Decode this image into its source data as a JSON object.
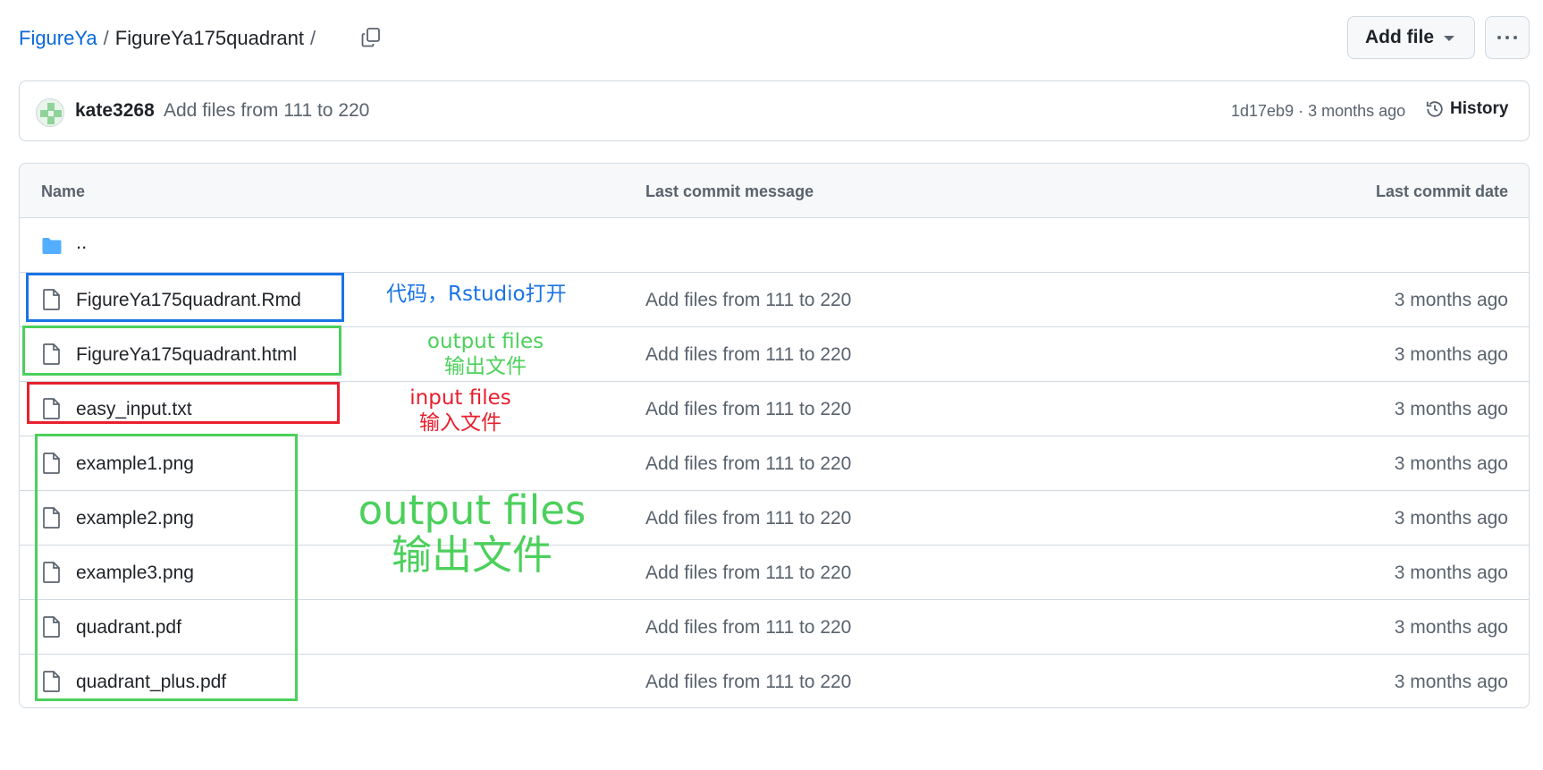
{
  "breadcrumb": {
    "owner": "FigureYa",
    "sep1": "/",
    "folder": "FigureYa175quadrant",
    "sep2": "/"
  },
  "actions": {
    "add_file_label": "Add file",
    "copy_icon": "copy-icon",
    "more_icon": "kebab-horizontal-icon"
  },
  "commit": {
    "author": "kate3268",
    "message": "Add files from 111 to 220",
    "meta": "1d17eb9 · 3 months ago",
    "history_label": "History"
  },
  "table": {
    "headers": {
      "name": "Name",
      "message": "Last commit message",
      "date": "Last commit date"
    },
    "parent": "..",
    "rows": [
      {
        "name": "FigureYa175quadrant.Rmd",
        "message": "Add files from 111 to 220",
        "date": "3 months ago"
      },
      {
        "name": "FigureYa175quadrant.html",
        "message": "Add files from 111 to 220",
        "date": "3 months ago"
      },
      {
        "name": "easy_input.txt",
        "message": "Add files from 111 to 220",
        "date": "3 months ago"
      },
      {
        "name": "example1.png",
        "message": "Add files from 111 to 220",
        "date": "3 months ago"
      },
      {
        "name": "example2.png",
        "message": "Add files from 111 to 220",
        "date": "3 months ago"
      },
      {
        "name": "example3.png",
        "message": "Add files from 111 to 220",
        "date": "3 months ago"
      },
      {
        "name": "quadrant.pdf",
        "message": "Add files from 111 to 220",
        "date": "3 months ago"
      },
      {
        "name": "quadrant_plus.pdf",
        "message": "Add files from 111 to 220",
        "date": "3 months ago"
      }
    ]
  },
  "annotations": {
    "code": "代码，Rstudio打开",
    "output_small_en": "output files",
    "output_small_zh": "输出文件",
    "input_en": "input files",
    "input_zh": "输入文件",
    "output_large_en": "output files",
    "output_large_zh": "输出文件"
  },
  "colors": {
    "link": "#0969da",
    "annotation_blue": "#1a73e8",
    "annotation_green": "#4cd05c",
    "annotation_red": "#e8202e",
    "folder": "#54aeff"
  }
}
